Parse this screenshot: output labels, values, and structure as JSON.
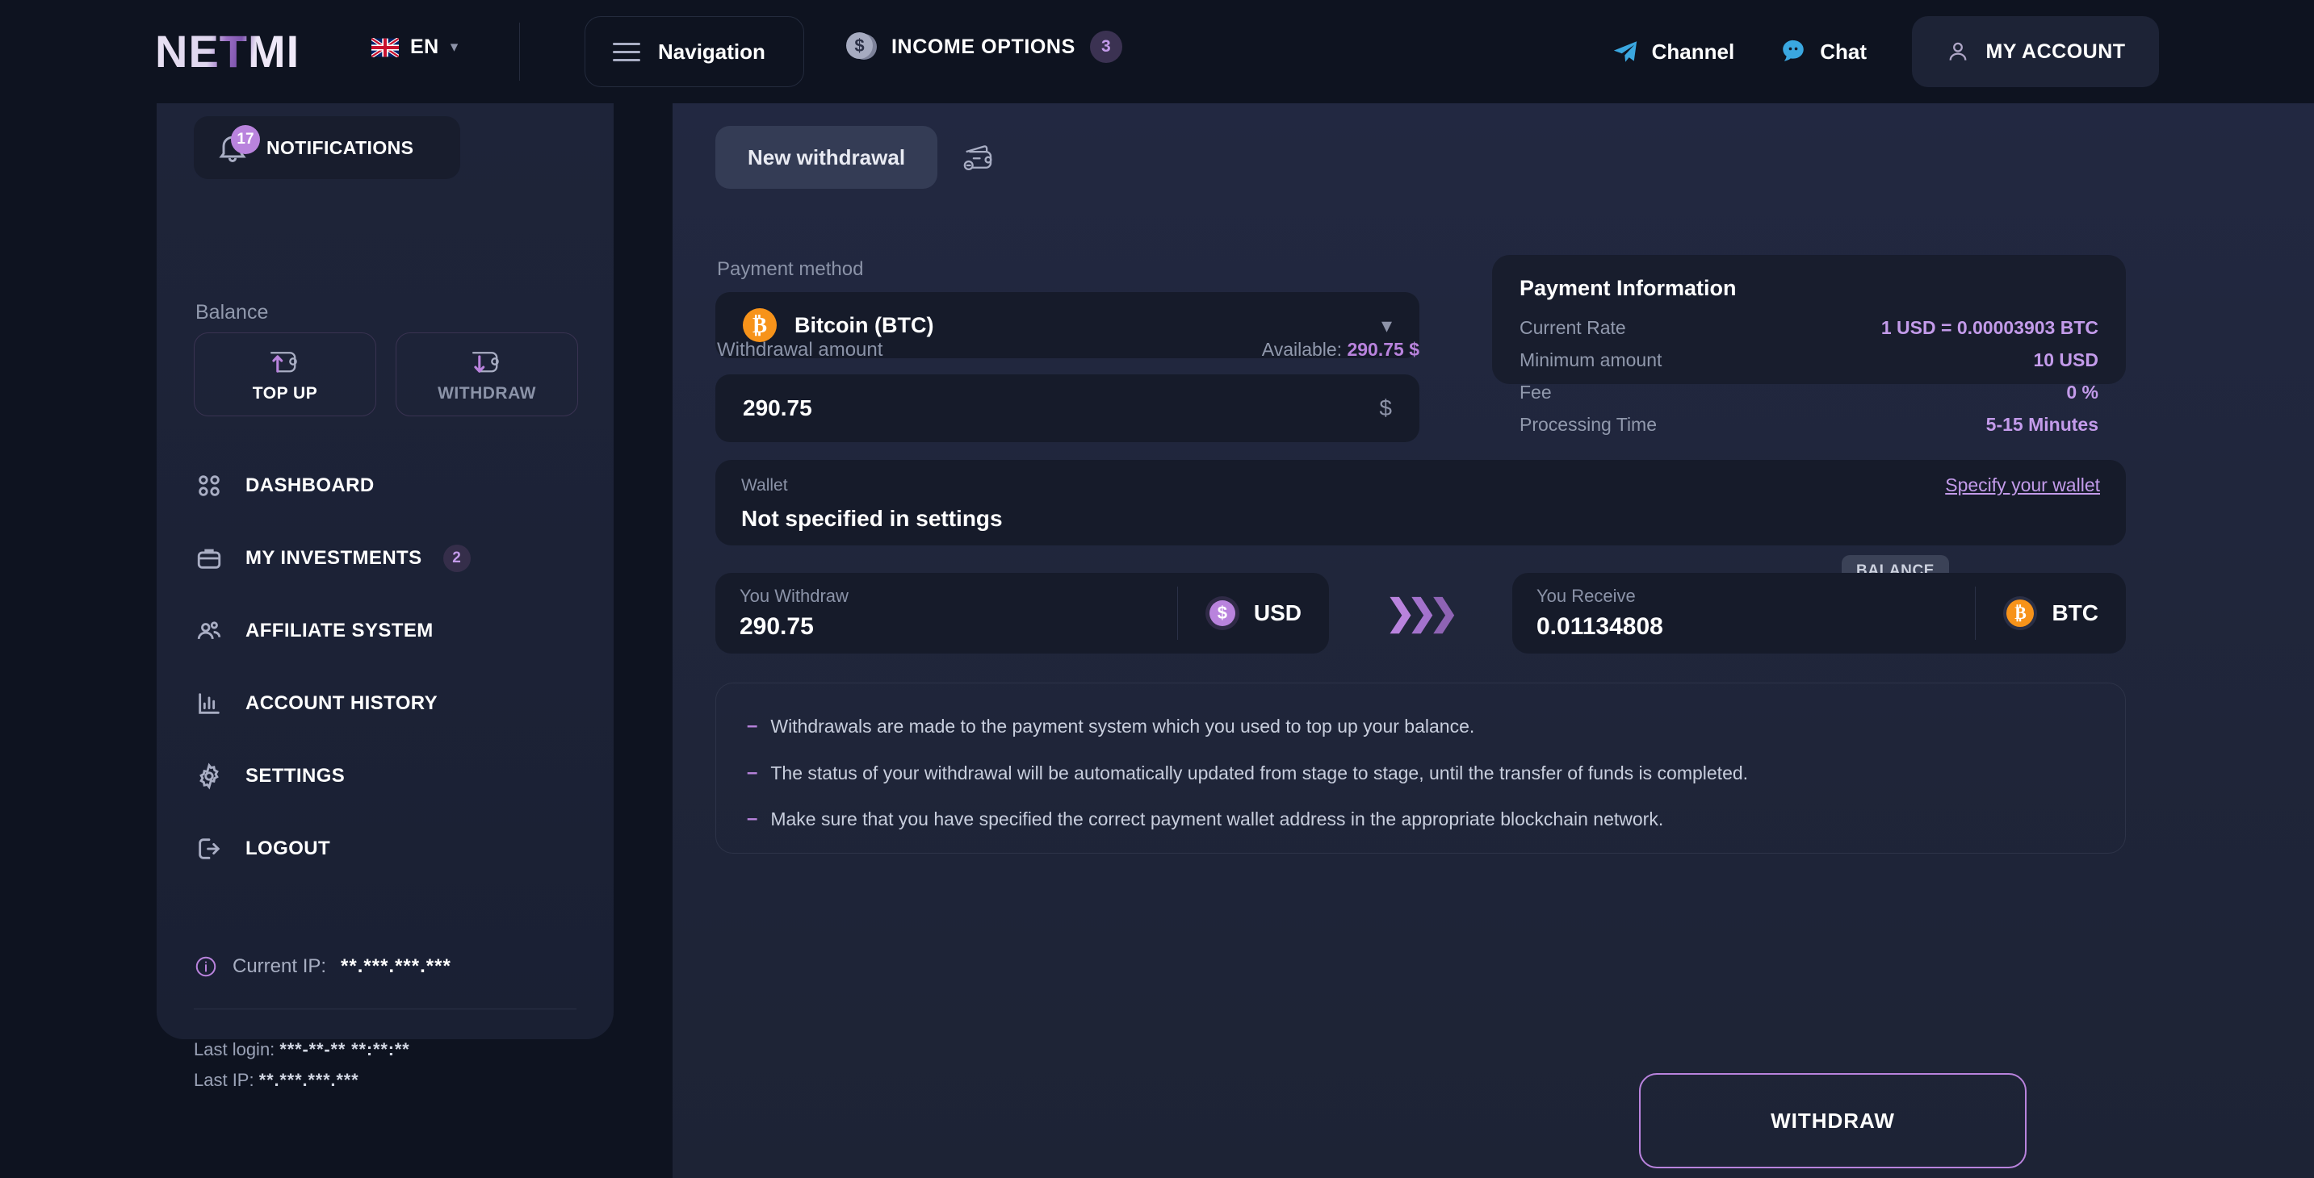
{
  "header": {
    "logo": "NETMI",
    "language": {
      "code": "EN",
      "flag": "uk-flag-icon"
    },
    "navigation_label": "Navigation",
    "income_options_label": "INCOME OPTIONS",
    "income_options_count": "3",
    "channel_label": "Channel",
    "chat_label": "Chat",
    "account_label": "MY ACCOUNT"
  },
  "sidebar": {
    "notifications_label": "NOTIFICATIONS",
    "notifications_count": "17",
    "balance_label": "Balance",
    "balance_actions": [
      {
        "label": "TOP UP",
        "icon": "wallet-up-icon",
        "active": true
      },
      {
        "label": "WITHDRAW",
        "icon": "wallet-down-icon",
        "active": false
      }
    ],
    "items": [
      {
        "label": "DASHBOARD",
        "icon": "grid-icon",
        "count": ""
      },
      {
        "label": "MY INVESTMENTS",
        "icon": "briefcase-icon",
        "count": "2"
      },
      {
        "label": "AFFILIATE SYSTEM",
        "icon": "users-icon",
        "count": ""
      },
      {
        "label": "ACCOUNT HISTORY",
        "icon": "bar-chart-icon",
        "count": ""
      },
      {
        "label": "SETTINGS",
        "icon": "gear-icon",
        "count": ""
      },
      {
        "label": "LOGOUT",
        "icon": "logout-icon",
        "count": ""
      }
    ],
    "current_ip_label": "Current IP:",
    "current_ip_value": "**.***.***.***",
    "last_login_label": "Last login:",
    "last_login_value": "***-**-** **:**:**",
    "last_ip_label": "Last IP:",
    "last_ip_value": "**.***.***.***"
  },
  "main": {
    "tab_label": "New withdrawal",
    "payment_method_label": "Payment method",
    "payment_method_value": "Bitcoin (BTC)",
    "withdrawal_amount_label": "Withdrawal amount",
    "available_label": "Available:",
    "available_value": "290.75 $",
    "amount_value": "290.75",
    "amount_currency_symbol": "$",
    "payment_information": {
      "title": "Payment Information",
      "rows": [
        {
          "key": "Current Rate",
          "value": "1 USD = 0.00003903 BTC"
        },
        {
          "key": "Minimum amount",
          "value": "10 USD"
        },
        {
          "key": "Fee",
          "value": "0 %"
        },
        {
          "key": "Processing Time",
          "value": "5-15 Minutes"
        }
      ]
    },
    "wallet": {
      "label": "Wallet",
      "value": "Not specified in settings",
      "link": "Specify your wallet"
    },
    "exchange": {
      "withdraw_label": "You Withdraw",
      "withdraw_value": "290.75",
      "withdraw_currency": "USD",
      "balance_tag": "BALANCE",
      "receive_label": "You Receive",
      "receive_value": "0.01134808",
      "receive_currency": "BTC"
    },
    "notes": [
      "Withdrawals are made to the payment system which you used to top up your balance.",
      "The status of your withdrawal will be automatically updated from stage to stage, until the transfer of funds is completed.",
      "Make sure that you have specified the correct payment wallet address in the appropriate blockchain network."
    ],
    "withdraw_button_label": "WITHDRAW"
  },
  "colors": {
    "accent": "#b983dd",
    "bitcoin": "#f7931a",
    "telegram": "#3aa7e0",
    "page_bg": "#0e1320",
    "panel_bg": "#222841"
  }
}
